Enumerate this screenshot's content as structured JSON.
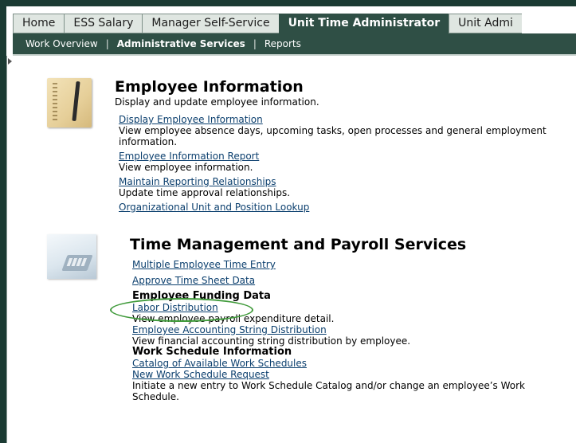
{
  "tabs": [
    {
      "label": "Home",
      "active": false
    },
    {
      "label": "ESS Salary",
      "active": false
    },
    {
      "label": "Manager Self-Service",
      "active": false
    },
    {
      "label": "Unit Time Administrator",
      "active": true
    },
    {
      "label": "Unit Admi",
      "active": false
    }
  ],
  "subnav": {
    "work_overview": "Work Overview",
    "separator": "|",
    "administrative_services": "Administrative Services",
    "reports": "Reports"
  },
  "employee_information": {
    "title": "Employee Information",
    "subtitle": "Display and update employee information.",
    "icon": "notebook-icon",
    "items": [
      {
        "link": "Display Employee Information",
        "description": "View employee absence days, upcoming tasks, open processes and general employment information."
      },
      {
        "link": "Employee Information Report",
        "description": "View employee information."
      },
      {
        "link": "Maintain Reporting Relationships",
        "description": "Update time approval relationships."
      },
      {
        "link": "Organizational Unit and Position Lookup",
        "description": ""
      }
    ]
  },
  "time_management": {
    "title": "Time Management and Payroll Services",
    "icon": "calculator-icon",
    "links_top": [
      "Multiple Employee Time Entry",
      "Approve Time Sheet Data"
    ],
    "funding_heading": "Employee Funding Data",
    "funding_items": [
      {
        "link": "Labor Distribution",
        "description": "View employee payroll expenditure detail."
      },
      {
        "link": "Employee Accounting String Distribution",
        "description": "View financial accounting string distribution by employee."
      }
    ],
    "schedule_heading": "Work Schedule Information",
    "schedule_items": [
      {
        "link": "Catalog of Available Work Schedules",
        "description": ""
      },
      {
        "link": "New Work Schedule Request",
        "description": "Initiate a new entry to Work Schedule Catalog and/or change an employee’s Work Schedule."
      }
    ]
  },
  "colors": {
    "nav_dark": "#2f4f45",
    "tab_bg": "#dfe6e1",
    "link": "#0b3f6e",
    "highlight": "#3f9a3a"
  }
}
